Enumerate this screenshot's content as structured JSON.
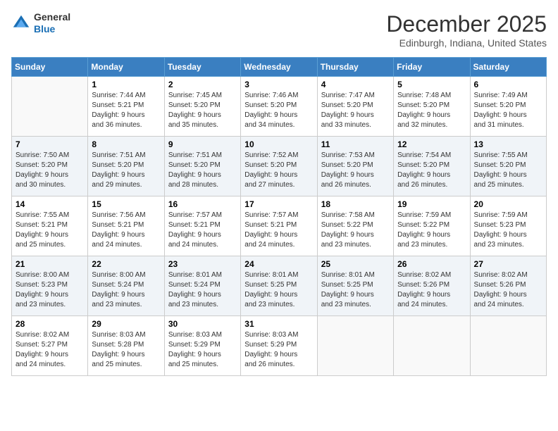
{
  "logo": {
    "general": "General",
    "blue": "Blue"
  },
  "title": "December 2025",
  "location": "Edinburgh, Indiana, United States",
  "days_of_week": [
    "Sunday",
    "Monday",
    "Tuesday",
    "Wednesday",
    "Thursday",
    "Friday",
    "Saturday"
  ],
  "weeks": [
    [
      {
        "day": "",
        "info": ""
      },
      {
        "day": "1",
        "info": "Sunrise: 7:44 AM\nSunset: 5:21 PM\nDaylight: 9 hours\nand 36 minutes."
      },
      {
        "day": "2",
        "info": "Sunrise: 7:45 AM\nSunset: 5:20 PM\nDaylight: 9 hours\nand 35 minutes."
      },
      {
        "day": "3",
        "info": "Sunrise: 7:46 AM\nSunset: 5:20 PM\nDaylight: 9 hours\nand 34 minutes."
      },
      {
        "day": "4",
        "info": "Sunrise: 7:47 AM\nSunset: 5:20 PM\nDaylight: 9 hours\nand 33 minutes."
      },
      {
        "day": "5",
        "info": "Sunrise: 7:48 AM\nSunset: 5:20 PM\nDaylight: 9 hours\nand 32 minutes."
      },
      {
        "day": "6",
        "info": "Sunrise: 7:49 AM\nSunset: 5:20 PM\nDaylight: 9 hours\nand 31 minutes."
      }
    ],
    [
      {
        "day": "7",
        "info": "Sunrise: 7:50 AM\nSunset: 5:20 PM\nDaylight: 9 hours\nand 30 minutes."
      },
      {
        "day": "8",
        "info": "Sunrise: 7:51 AM\nSunset: 5:20 PM\nDaylight: 9 hours\nand 29 minutes."
      },
      {
        "day": "9",
        "info": "Sunrise: 7:51 AM\nSunset: 5:20 PM\nDaylight: 9 hours\nand 28 minutes."
      },
      {
        "day": "10",
        "info": "Sunrise: 7:52 AM\nSunset: 5:20 PM\nDaylight: 9 hours\nand 27 minutes."
      },
      {
        "day": "11",
        "info": "Sunrise: 7:53 AM\nSunset: 5:20 PM\nDaylight: 9 hours\nand 26 minutes."
      },
      {
        "day": "12",
        "info": "Sunrise: 7:54 AM\nSunset: 5:20 PM\nDaylight: 9 hours\nand 26 minutes."
      },
      {
        "day": "13",
        "info": "Sunrise: 7:55 AM\nSunset: 5:20 PM\nDaylight: 9 hours\nand 25 minutes."
      }
    ],
    [
      {
        "day": "14",
        "info": "Sunrise: 7:55 AM\nSunset: 5:21 PM\nDaylight: 9 hours\nand 25 minutes."
      },
      {
        "day": "15",
        "info": "Sunrise: 7:56 AM\nSunset: 5:21 PM\nDaylight: 9 hours\nand 24 minutes."
      },
      {
        "day": "16",
        "info": "Sunrise: 7:57 AM\nSunset: 5:21 PM\nDaylight: 9 hours\nand 24 minutes."
      },
      {
        "day": "17",
        "info": "Sunrise: 7:57 AM\nSunset: 5:21 PM\nDaylight: 9 hours\nand 24 minutes."
      },
      {
        "day": "18",
        "info": "Sunrise: 7:58 AM\nSunset: 5:22 PM\nDaylight: 9 hours\nand 23 minutes."
      },
      {
        "day": "19",
        "info": "Sunrise: 7:59 AM\nSunset: 5:22 PM\nDaylight: 9 hours\nand 23 minutes."
      },
      {
        "day": "20",
        "info": "Sunrise: 7:59 AM\nSunset: 5:23 PM\nDaylight: 9 hours\nand 23 minutes."
      }
    ],
    [
      {
        "day": "21",
        "info": "Sunrise: 8:00 AM\nSunset: 5:23 PM\nDaylight: 9 hours\nand 23 minutes."
      },
      {
        "day": "22",
        "info": "Sunrise: 8:00 AM\nSunset: 5:24 PM\nDaylight: 9 hours\nand 23 minutes."
      },
      {
        "day": "23",
        "info": "Sunrise: 8:01 AM\nSunset: 5:24 PM\nDaylight: 9 hours\nand 23 minutes."
      },
      {
        "day": "24",
        "info": "Sunrise: 8:01 AM\nSunset: 5:25 PM\nDaylight: 9 hours\nand 23 minutes."
      },
      {
        "day": "25",
        "info": "Sunrise: 8:01 AM\nSunset: 5:25 PM\nDaylight: 9 hours\nand 23 minutes."
      },
      {
        "day": "26",
        "info": "Sunrise: 8:02 AM\nSunset: 5:26 PM\nDaylight: 9 hours\nand 24 minutes."
      },
      {
        "day": "27",
        "info": "Sunrise: 8:02 AM\nSunset: 5:26 PM\nDaylight: 9 hours\nand 24 minutes."
      }
    ],
    [
      {
        "day": "28",
        "info": "Sunrise: 8:02 AM\nSunset: 5:27 PM\nDaylight: 9 hours\nand 24 minutes."
      },
      {
        "day": "29",
        "info": "Sunrise: 8:03 AM\nSunset: 5:28 PM\nDaylight: 9 hours\nand 25 minutes."
      },
      {
        "day": "30",
        "info": "Sunrise: 8:03 AM\nSunset: 5:29 PM\nDaylight: 9 hours\nand 25 minutes."
      },
      {
        "day": "31",
        "info": "Sunrise: 8:03 AM\nSunset: 5:29 PM\nDaylight: 9 hours\nand 26 minutes."
      },
      {
        "day": "",
        "info": ""
      },
      {
        "day": "",
        "info": ""
      },
      {
        "day": "",
        "info": ""
      }
    ]
  ]
}
